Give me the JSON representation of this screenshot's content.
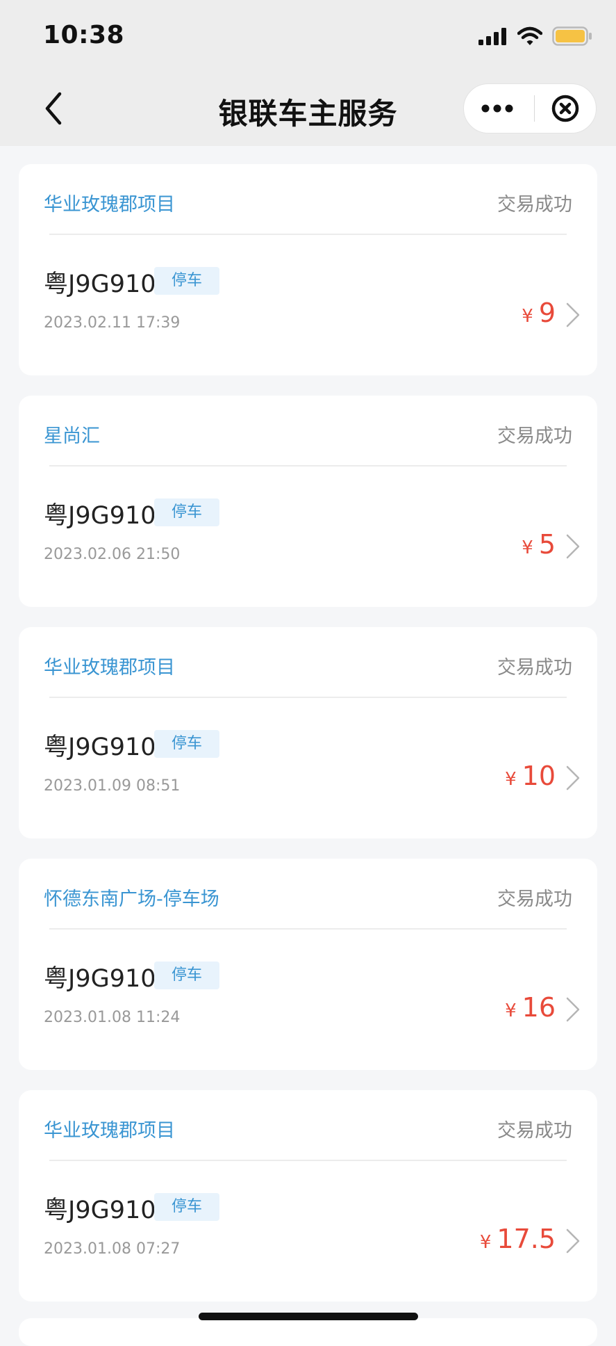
{
  "status_bar": {
    "time": "10:38",
    "icons": [
      "signal-icon",
      "wifi-icon",
      "battery-icon"
    ],
    "battery_color": "#f6c244"
  },
  "nav": {
    "title": "银联车主服务",
    "back_icon": "chevron-left-icon",
    "more_icon": "more-dots-icon",
    "close_icon": "close-circle-icon"
  },
  "colors": {
    "merchant": "#3a95d2",
    "amount": "#e84a3a",
    "status": "#8a8a8a",
    "tag_bg": "#e8f3fc"
  },
  "transactions": [
    {
      "merchant": "华业玫瑰郡项目",
      "status": "交易成功",
      "plate": "粤J9G910",
      "tag": "停车",
      "time": "2023.02.11 17:39",
      "currency": "¥",
      "amount": "9"
    },
    {
      "merchant": "星尚汇",
      "status": "交易成功",
      "plate": "粤J9G910",
      "tag": "停车",
      "time": "2023.02.06 21:50",
      "currency": "¥",
      "amount": "5"
    },
    {
      "merchant": "华业玫瑰郡项目",
      "status": "交易成功",
      "plate": "粤J9G910",
      "tag": "停车",
      "time": "2023.01.09 08:51",
      "currency": "¥",
      "amount": "10"
    },
    {
      "merchant": "怀德东南广场-停车场",
      "status": "交易成功",
      "plate": "粤J9G910",
      "tag": "停车",
      "time": "2023.01.08 11:24",
      "currency": "¥",
      "amount": "16"
    },
    {
      "merchant": "华业玫瑰郡项目",
      "status": "交易成功",
      "plate": "粤J9G910",
      "tag": "停车",
      "time": "2023.01.08 07:27",
      "currency": "¥",
      "amount": "17.5"
    }
  ]
}
